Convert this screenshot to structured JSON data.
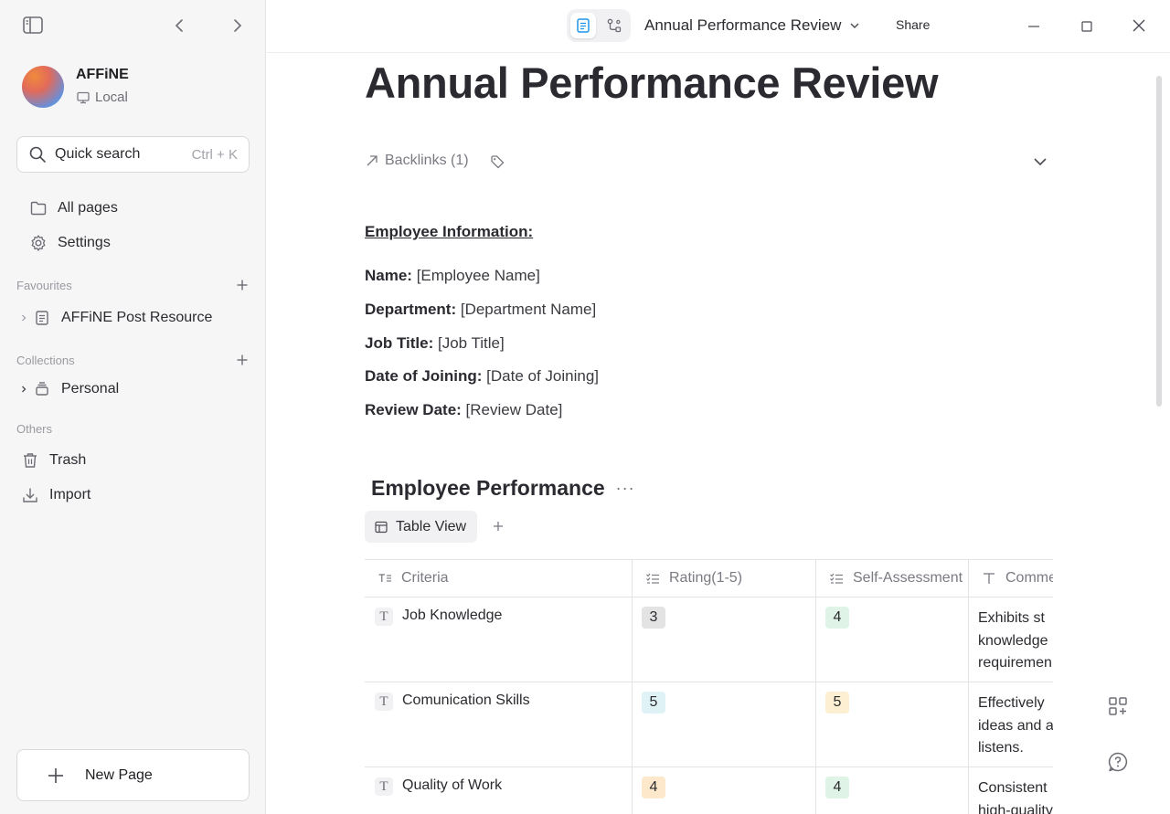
{
  "sidebar": {
    "workspace_name": "AFFiNE",
    "workspace_location": "Local",
    "search_label": "Quick search",
    "search_shortcut": "Ctrl + K",
    "nav": [
      {
        "label": "All pages",
        "icon": "folder-icon"
      },
      {
        "label": "Settings",
        "icon": "gear-icon"
      }
    ],
    "favourites_label": "Favourites",
    "favourites": [
      {
        "label": "AFFiNE Post Resource",
        "icon": "page-icon"
      }
    ],
    "collections_label": "Collections",
    "collections": [
      {
        "label": "Personal",
        "icon": "collection-icon"
      }
    ],
    "others_label": "Others",
    "others": [
      {
        "label": "Trash",
        "icon": "trash-icon"
      },
      {
        "label": "Import",
        "icon": "import-icon"
      }
    ],
    "new_page_label": "New Page"
  },
  "topbar": {
    "doc_title": "Annual Performance Review",
    "share_label": "Share",
    "mode": "page"
  },
  "page": {
    "title": "Annual Performance Review",
    "backlinks_label": "Backlinks (1)",
    "info_heading": "Employee Information:",
    "info": [
      {
        "label": "Name:",
        "value": " [Employee Name]"
      },
      {
        "label": "Department:",
        "value": " [Department Name]"
      },
      {
        "label": "Job Title:",
        "value": " [Job Title]"
      },
      {
        "label": "Date of Joining:",
        "value": " [Date of Joining]"
      },
      {
        "label": "Review Date:",
        "value": " [Review Date]"
      }
    ],
    "database": {
      "title": "Employee Performance",
      "more_label": "···",
      "view_label": "Table View",
      "columns": [
        "Criteria",
        "Rating(1-5)",
        "Self-Assessment",
        "Comme"
      ],
      "rows": [
        {
          "criteria": "Job Knowledge",
          "rating": "3",
          "rating_color": "#e3e3e3",
          "self": "4",
          "self_color": "#dff4e6",
          "comment": [
            " Exhibits st",
            "knowledge",
            "requiremen"
          ]
        },
        {
          "criteria": "Comunication Skills",
          "rating": "5",
          "rating_color": "#dff3f7",
          "self": "5",
          "self_color": "#fdf0d2",
          "comment": [
            "Effectively",
            "ideas and a",
            "listens."
          ]
        },
        {
          "criteria": "Quality of Work",
          "rating": "4",
          "rating_color": "#fde8cc",
          "self": "4",
          "self_color": "#dff4e6",
          "comment": [
            " Consistent",
            "high-quality"
          ]
        }
      ]
    }
  },
  "colors": {
    "accent": "#1e96eb",
    "sidebar_bg": "#f6f6f7",
    "text": "#2a2a30"
  }
}
